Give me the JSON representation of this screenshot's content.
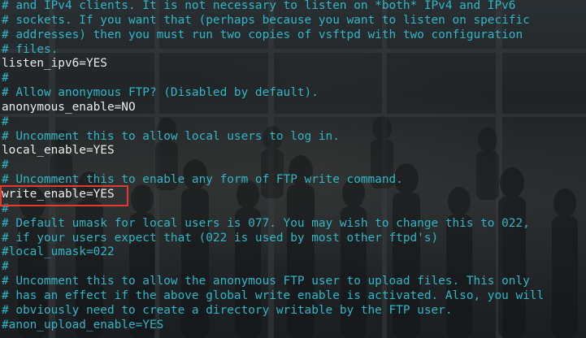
{
  "terminal": {
    "lines": [
      {
        "text": "# and IPv4 clients. It is not necessary to listen on *both* IPv4 and IPv6",
        "kind": "comment"
      },
      {
        "text": "# sockets. If you want that (perhaps because you want to listen on specific",
        "kind": "comment"
      },
      {
        "text": "# addresses) then you must run two copies of vsftpd with two configuration",
        "kind": "comment"
      },
      {
        "text": "# files.",
        "kind": "comment"
      },
      {
        "text": "listen_ipv6=YES",
        "kind": "directive"
      },
      {
        "text": "#",
        "kind": "comment"
      },
      {
        "text": "# Allow anonymous FTP? (Disabled by default).",
        "kind": "comment"
      },
      {
        "text": "anonymous_enable=NO",
        "kind": "directive"
      },
      {
        "text": "#",
        "kind": "comment"
      },
      {
        "text": "# Uncomment this to allow local users to log in.",
        "kind": "comment"
      },
      {
        "text": "local_enable=YES",
        "kind": "directive"
      },
      {
        "text": "#",
        "kind": "comment"
      },
      {
        "text": "# Uncomment this to enable any form of FTP write command.",
        "kind": "comment"
      },
      {
        "text": "write_enable=YES",
        "kind": "directive"
      },
      {
        "text": "#",
        "kind": "comment"
      },
      {
        "text": "# Default umask for local users is 077. You may wish to change this to 022,",
        "kind": "comment"
      },
      {
        "text": "# if your users expect that (022 is used by most other ftpd's)",
        "kind": "comment"
      },
      {
        "text": "#local_umask=022",
        "kind": "comment"
      },
      {
        "text": "#",
        "kind": "comment"
      },
      {
        "text": "# Uncomment this to allow the anonymous FTP user to upload files. This only",
        "kind": "comment"
      },
      {
        "text": "# has an effect if the above global write enable is activated. Also, you will",
        "kind": "comment"
      },
      {
        "text": "# obviously need to create a directory writable by the FTP user.",
        "kind": "comment"
      },
      {
        "text": "#anon_upload_enable=YES",
        "kind": "comment"
      }
    ],
    "highlighted_line": "write_enable=YES"
  },
  "colors": {
    "comment": "#2fb7c6",
    "directive": "#ececec",
    "highlight_border": "#e23a2e",
    "background": "#1f2326"
  }
}
